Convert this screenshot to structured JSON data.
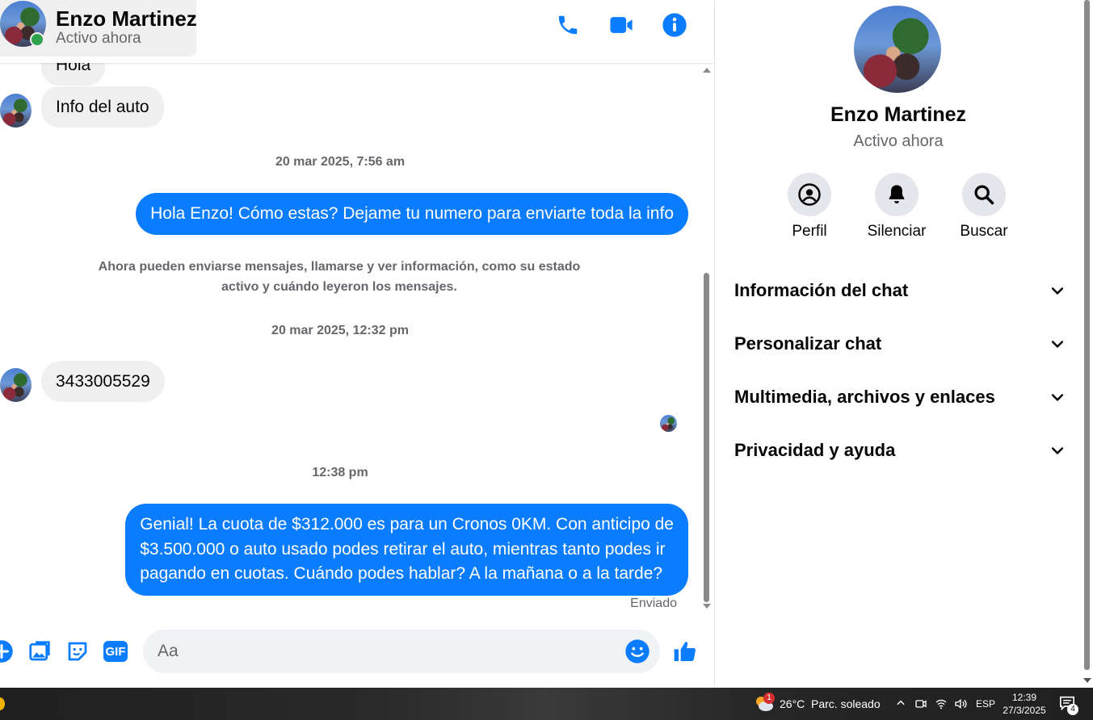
{
  "header": {
    "name": "Enzo Martinez",
    "status": "Activo ahora"
  },
  "messages": {
    "partial_in": "Hola",
    "info_auto": "Info del auto",
    "stamp1": "20 mar 2025, 7:56 am",
    "out1": "Hola Enzo! Cómo estas? Dejame tu numero para enviarte toda la info",
    "system_note_line1": "Ahora pueden enviarse mensajes, llamarse y ver información, como su estado",
    "system_note_line2": "activo y cuándo leyeron los mensajes.",
    "stamp2": "20 mar 2025, 12:32 pm",
    "phone": "3433005529",
    "stamp3": "12:38 pm",
    "out2_line1": "Genial! La cuota de $312.000 es para un Cronos 0KM. Con anticipo de",
    "out2_line2": "$3.500.000 o auto usado podes retirar el auto, mientras tanto podes ir",
    "out2_line3": "pagando en cuotas. Cuándo podes hablar? A la mañana o a la tarde?",
    "sent_label": "Enviado"
  },
  "composer": {
    "placeholder": "Aa",
    "gif_label": "GIF"
  },
  "panel": {
    "name": "Enzo Martinez",
    "status": "Activo ahora",
    "actions": [
      {
        "label": "Perfil",
        "icon": "profile-icon"
      },
      {
        "label": "Silenciar",
        "icon": "bell-icon"
      },
      {
        "label": "Buscar",
        "icon": "search-icon"
      }
    ],
    "sections": [
      "Información del chat",
      "Personalizar chat",
      "Multimedia, archivos y enlaces",
      "Privacidad y ayuda"
    ]
  },
  "taskbar": {
    "weather_badge": "1",
    "temperature": "26°C",
    "weather": "Parc. soleado",
    "language": "ESP",
    "time": "12:39",
    "date": "27/3/2025",
    "notifications": "4"
  },
  "colors": {
    "accent": "#0a7cff",
    "bubble_in": "#f0f0f0",
    "online": "#31a24c"
  }
}
